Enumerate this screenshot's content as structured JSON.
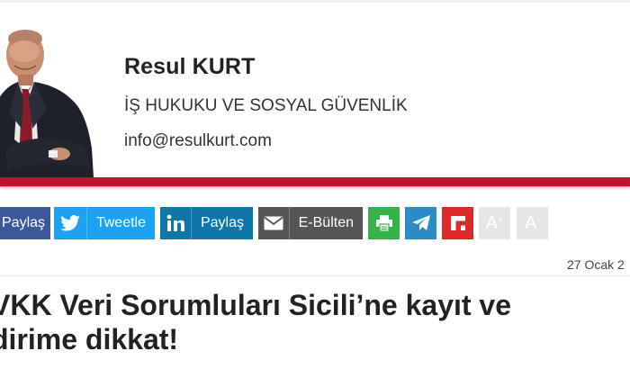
{
  "author": {
    "name": "Resul KURT",
    "title": "İŞ HUKUKU VE SOSYAL GÜVENLİK",
    "email": "info@resulkurt.com"
  },
  "share": {
    "facebook_label": "Paylaş",
    "twitter_label": "Tweetle",
    "linkedin_label": "Paylaş",
    "email_label": "E-Bülten",
    "font_increase_label": "A",
    "font_increase_sup": "+",
    "font_decrease_label": "A",
    "font_decrease_sup": "-"
  },
  "article": {
    "date": "27 Ocak 2",
    "headline_line1": "VKK Veri Sorumluları Sicili’ne kayıt ve",
    "headline_line2": "dirime dikkat!"
  },
  "colors": {
    "accent_red": "#c8102e",
    "facebook": "#3b5998",
    "twitter": "#1da1f2",
    "linkedin": "#0e76a8",
    "email": "#555555",
    "print": "#33b34a",
    "telegram": "#2a8cc7",
    "flipboard": "#e02828"
  },
  "icons": [
    "facebook-icon",
    "twitter-icon",
    "linkedin-icon",
    "envelope-icon",
    "print-icon",
    "telegram-icon",
    "flipboard-icon"
  ]
}
